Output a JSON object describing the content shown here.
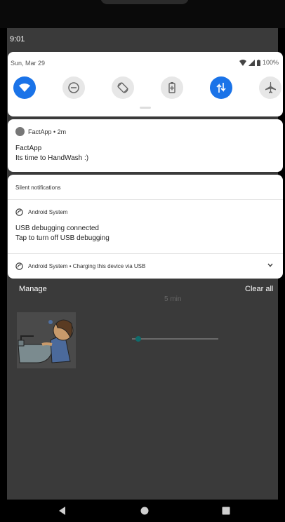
{
  "status_bar": {
    "time": "9:01"
  },
  "quick_settings": {
    "date": "Sun, Mar 29",
    "battery": "100%",
    "tiles": [
      {
        "icon": "wifi-icon",
        "active": true
      },
      {
        "icon": "do-not-disturb-icon",
        "active": false
      },
      {
        "icon": "auto-rotate-icon",
        "active": false
      },
      {
        "icon": "battery-saver-icon",
        "active": false
      },
      {
        "icon": "mobile-data-icon",
        "active": true
      },
      {
        "icon": "airplane-mode-icon",
        "active": false
      }
    ],
    "colors": {
      "active": "#1a73e8",
      "inactive": "#e7e7e7"
    }
  },
  "notifications": {
    "factapp": {
      "header": "FactApp • 2m",
      "title": "FactApp",
      "text": "Its time to HandWash :)"
    },
    "silent": {
      "heading": "Silent notifications",
      "usb_debugging": {
        "app": "Android System",
        "title": "USB debugging connected",
        "text": "Tap to turn off USB debugging"
      },
      "charging": {
        "summary": "Android System • Charging this device via USB"
      }
    }
  },
  "actions": {
    "manage": "Manage",
    "clear_all": "Clear all"
  },
  "background_app": {
    "timer_label": "5 min",
    "slider_level": 0.05
  },
  "navigation": {
    "back": "back-icon",
    "home": "home-icon",
    "recents": "recents-icon"
  }
}
